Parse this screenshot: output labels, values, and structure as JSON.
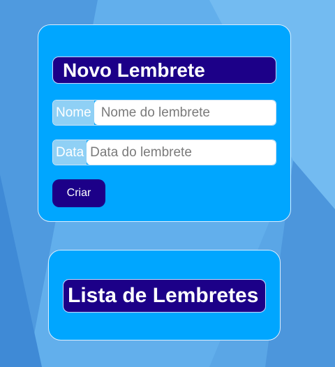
{
  "form": {
    "title": "Novo Lembrete",
    "name_label": "Nome",
    "name_placeholder": "Nome do lembrete",
    "name_value": "",
    "date_label": "Data",
    "date_placeholder": "Data do lembrete",
    "date_value": "",
    "submit_label": "Criar"
  },
  "list": {
    "title": "Lista de Lembretes"
  },
  "colors": {
    "card_bg": "#00a6ff",
    "heading_bg": "#1c0088",
    "button_bg": "#1c0088",
    "label_bg": "#8fd0f5",
    "page_bg": "#5aa6e6"
  }
}
